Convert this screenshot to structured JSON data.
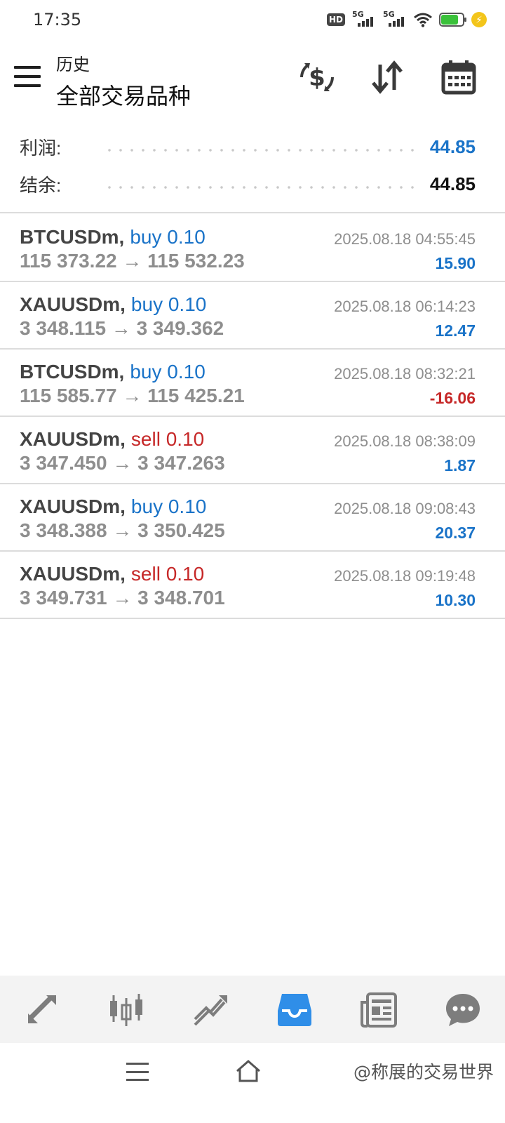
{
  "status_bar": {
    "time": "17:35",
    "hd_label": "HD",
    "network_1": "5G",
    "network_2": "5G",
    "battery_level": 0.8
  },
  "header": {
    "subtitle": "历史",
    "title": "全部交易品种"
  },
  "summary": {
    "profit_label": "利润:",
    "profit_value": "44.85",
    "balance_label": "结余:",
    "balance_value": "44.85"
  },
  "trades": [
    {
      "symbol": "BTCUSDm,",
      "side": "buy 0.10",
      "direction": "buy",
      "prices": "115 373.22 → 115 532.23",
      "time": "2025.08.18 04:55:45",
      "profit": "15.90"
    },
    {
      "symbol": "XAUUSDm,",
      "side": "buy 0.10",
      "direction": "buy",
      "prices": "3 348.115 → 3 349.362",
      "time": "2025.08.18 06:14:23",
      "profit": "12.47"
    },
    {
      "symbol": "BTCUSDm,",
      "side": "buy 0.10",
      "direction": "buy",
      "prices": "115 585.77 → 115 425.21",
      "time": "2025.08.18 08:32:21",
      "profit": "-16.06"
    },
    {
      "symbol": "XAUUSDm,",
      "side": "sell 0.10",
      "direction": "sell",
      "prices": "3 347.450 → 3 347.263",
      "time": "2025.08.18 08:38:09",
      "profit": "1.87"
    },
    {
      "symbol": "XAUUSDm,",
      "side": "buy 0.10",
      "direction": "buy",
      "prices": "3 348.388 → 3 350.425",
      "time": "2025.08.18 09:08:43",
      "profit": "20.37"
    },
    {
      "symbol": "XAUUSDm,",
      "side": "sell 0.10",
      "direction": "sell",
      "prices": "3 349.731 → 3 348.701",
      "time": "2025.08.18 09:19:48",
      "profit": "10.30"
    }
  ],
  "bottom_nav": [
    {
      "icon": "quotes-icon",
      "active": false
    },
    {
      "icon": "chart-icon",
      "active": false
    },
    {
      "icon": "trade-icon",
      "active": false
    },
    {
      "icon": "history-icon",
      "active": true
    },
    {
      "icon": "news-icon",
      "active": false
    },
    {
      "icon": "chat-icon",
      "active": false
    }
  ],
  "watermark": "@称展的交易世界",
  "colors": {
    "blue": "#1a73c8",
    "red": "#c62828",
    "nav_active": "#2f8ee8",
    "nav_inactive": "#7d7d7d"
  }
}
